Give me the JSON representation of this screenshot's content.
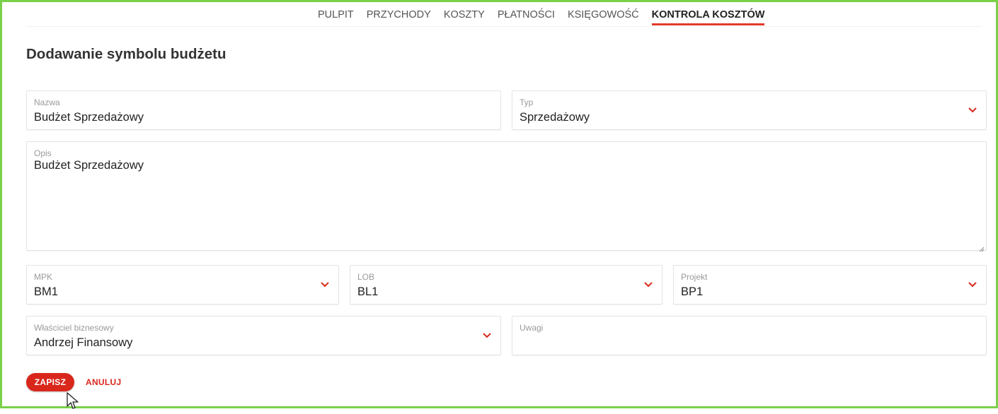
{
  "nav": {
    "items": [
      {
        "label": "PULPIT",
        "active": false
      },
      {
        "label": "PRZYCHODY",
        "active": false
      },
      {
        "label": "KOSZTY",
        "active": false
      },
      {
        "label": "PŁATNOŚCI",
        "active": false
      },
      {
        "label": "KSIĘGOWOŚĆ",
        "active": false
      },
      {
        "label": "KONTROLA KOSZTÓW",
        "active": true
      }
    ]
  },
  "page": {
    "title": "Dodawanie symbolu budżetu"
  },
  "form": {
    "nazwa": {
      "label": "Nazwa",
      "value": "Budżet Sprzedażowy"
    },
    "typ": {
      "label": "Typ",
      "value": "Sprzedażowy"
    },
    "opis": {
      "label": "Opis",
      "value": "Budżet Sprzedażowy"
    },
    "mpk": {
      "label": "MPK",
      "value": "BM1"
    },
    "lob": {
      "label": "LOB",
      "value": "BL1"
    },
    "projekt": {
      "label": "Projekt",
      "value": "BP1"
    },
    "wlasciciel": {
      "label": "Właściciel biznesowy",
      "value": "Andrzej Finansowy"
    },
    "uwagi": {
      "label": "Uwagi",
      "value": ""
    }
  },
  "actions": {
    "save_label": "ZAPISZ",
    "cancel_label": "ANULUJ"
  },
  "colors": {
    "accent": "#d9271c",
    "frame": "#7bd04a"
  },
  "icons": {
    "dropdown": "chevron-down-icon",
    "cursor": "mouse-pointer-icon"
  }
}
